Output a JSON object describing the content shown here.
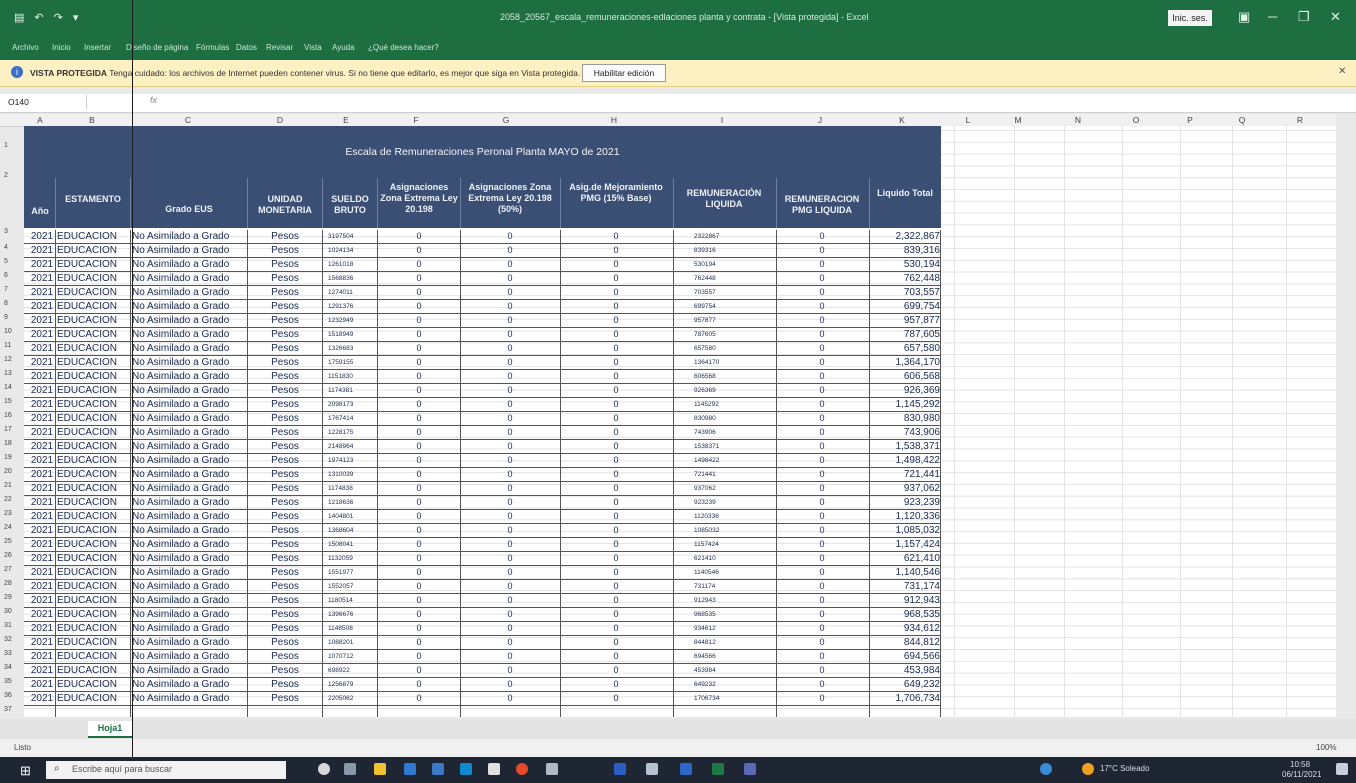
{
  "window": {
    "filename": "2058_20567_escala_remuneraciones-edlaciones planta y contrata - [Vista protegida] - Excel",
    "signin_label": "Inic. ses."
  },
  "ribbon_tabs": [
    "Archivo",
    "Inicio",
    "Insertar",
    "Diseño de página",
    "Fórmulas",
    "Datos",
    "Revisar",
    "Vista",
    "Ayuda",
    "¿Qué desea hacer?"
  ],
  "protected_view": {
    "label": "VISTA PROTEGIDA",
    "message": "Tenga cuidado: los archivos de Internet pueden contener virus. Si no tiene que editarlo, es mejor que siga en Vista protegida.",
    "enable_button": "Habilitar edición"
  },
  "formula_bar": {
    "name_box": "O140",
    "fx": "fx"
  },
  "columns": [
    "A",
    "B",
    "C",
    "D",
    "E",
    "F",
    "G",
    "H",
    "I",
    "J",
    "K",
    "L",
    "M",
    "N",
    "O",
    "P",
    "Q",
    "R"
  ],
  "table": {
    "title": "Escala de Remuneraciones Peronal Planta MAYO de 2021",
    "headers": [
      "Año",
      "ESTAMENTO",
      "Grado EUS",
      "UNIDAD MONETARIA",
      "SUELDO BRUTO",
      "Asignaciones Zona Extrema Ley 20.198",
      "Asignaciones Zona Extrema Ley 20.198 (50%)",
      "Asig.de Mejoramiento PMG (15% Base)",
      "REMUNERACIÓN LIQUIDA",
      "REMUNERACION PMG LIQUIDA",
      "Liquido Total"
    ],
    "rows": [
      [
        "2021",
        "EDUCACION",
        "No Asimilado a Grado",
        "Pesos",
        "3197504",
        "0",
        "0",
        "0",
        "2322867",
        "0",
        "2,322,867"
      ],
      [
        "2021",
        "EDUCACION",
        "No Asimilado a Grado",
        "Pesos",
        "1024134",
        "0",
        "0",
        "0",
        "839316",
        "0",
        "839,316"
      ],
      [
        "2021",
        "EDUCACION",
        "No Asimilado a Grado",
        "Pesos",
        "1261018",
        "0",
        "0",
        "0",
        "530194",
        "0",
        "530,194"
      ],
      [
        "2021",
        "EDUCACION",
        "No Asimilado a Grado",
        "Pesos",
        "1568836",
        "0",
        "0",
        "0",
        "762448",
        "0",
        "762,448"
      ],
      [
        "2021",
        "EDUCACION",
        "No Asimilado a Grado",
        "Pesos",
        "1274011",
        "0",
        "0",
        "0",
        "703557",
        "0",
        "703,557"
      ],
      [
        "2021",
        "EDUCACION",
        "No Asimilado a Grado",
        "Pesos",
        "1291376",
        "0",
        "0",
        "0",
        "699754",
        "0",
        "699,754"
      ],
      [
        "2021",
        "EDUCACION",
        "No Asimilado a Grado",
        "Pesos",
        "1232949",
        "0",
        "0",
        "0",
        "957877",
        "0",
        "957,877"
      ],
      [
        "2021",
        "EDUCACION",
        "No Asimilado a Grado",
        "Pesos",
        "1518949",
        "0",
        "0",
        "0",
        "787605",
        "0",
        "787,605"
      ],
      [
        "2021",
        "EDUCACION",
        "No Asimilado a Grado",
        "Pesos",
        "1326683",
        "0",
        "0",
        "0",
        "657580",
        "0",
        "657,580"
      ],
      [
        "2021",
        "EDUCACION",
        "No Asimilado a Grado",
        "Pesos",
        "1759155",
        "0",
        "0",
        "0",
        "1364170",
        "0",
        "1,364,170"
      ],
      [
        "2021",
        "EDUCACION",
        "No Asimilado a Grado",
        "Pesos",
        "1151830",
        "0",
        "0",
        "0",
        "606568",
        "0",
        "606,568"
      ],
      [
        "2021",
        "EDUCACION",
        "No Asimilado a Grado",
        "Pesos",
        "1174381",
        "0",
        "0",
        "0",
        "926369",
        "0",
        "926,369"
      ],
      [
        "2021",
        "EDUCACION",
        "No Asimilado a Grado",
        "Pesos",
        "2098173",
        "0",
        "0",
        "0",
        "1145292",
        "0",
        "1,145,292"
      ],
      [
        "2021",
        "EDUCACION",
        "No Asimilado a Grado",
        "Pesos",
        "1767414",
        "0",
        "0",
        "0",
        "830980",
        "0",
        "830,980"
      ],
      [
        "2021",
        "EDUCACION",
        "No Asimilado a Grado",
        "Pesos",
        "1228175",
        "0",
        "0",
        "0",
        "743906",
        "0",
        "743,906"
      ],
      [
        "2021",
        "EDUCACION",
        "No Asimilado a Grado",
        "Pesos",
        "2148964",
        "0",
        "0",
        "0",
        "1538371",
        "0",
        "1,538,371"
      ],
      [
        "2021",
        "EDUCACION",
        "No Asimilado a Grado",
        "Pesos",
        "1974123",
        "0",
        "0",
        "0",
        "1498422",
        "0",
        "1,498,422"
      ],
      [
        "2021",
        "EDUCACION",
        "No Asimilado a Grado",
        "Pesos",
        "1310039",
        "0",
        "0",
        "0",
        "721441",
        "0",
        "721,441"
      ],
      [
        "2021",
        "EDUCACION",
        "No Asimilado a Grado",
        "Pesos",
        "1174838",
        "0",
        "0",
        "0",
        "937062",
        "0",
        "937,062"
      ],
      [
        "2021",
        "EDUCACION",
        "No Asimilado a Grado",
        "Pesos",
        "1218636",
        "0",
        "0",
        "0",
        "923239",
        "0",
        "923,239"
      ],
      [
        "2021",
        "EDUCACION",
        "No Asimilado a Grado",
        "Pesos",
        "1404801",
        "0",
        "0",
        "0",
        "1120336",
        "0",
        "1,120,336"
      ],
      [
        "2021",
        "EDUCACION",
        "No Asimilado a Grado",
        "Pesos",
        "1368604",
        "0",
        "0",
        "0",
        "1085032",
        "0",
        "1,085,032"
      ],
      [
        "2021",
        "EDUCACION",
        "No Asimilado a Grado",
        "Pesos",
        "1508041",
        "0",
        "0",
        "0",
        "1157424",
        "0",
        "1,157,424"
      ],
      [
        "2021",
        "EDUCACION",
        "No Asimilado a Grado",
        "Pesos",
        "1132059",
        "0",
        "0",
        "0",
        "621410",
        "0",
        "621,410"
      ],
      [
        "2021",
        "EDUCACION",
        "No Asimilado a Grado",
        "Pesos",
        "1551977",
        "0",
        "0",
        "0",
        "1140546",
        "0",
        "1,140,546"
      ],
      [
        "2021",
        "EDUCACION",
        "No Asimilado a Grado",
        "Pesos",
        "1552057",
        "0",
        "0",
        "0",
        "731174",
        "0",
        "731,174"
      ],
      [
        "2021",
        "EDUCACION",
        "No Asimilado a Grado",
        "Pesos",
        "1180514",
        "0",
        "0",
        "0",
        "912943",
        "0",
        "912,943"
      ],
      [
        "2021",
        "EDUCACION",
        "No Asimilado a Grado",
        "Pesos",
        "1396676",
        "0",
        "0",
        "0",
        "968535",
        "0",
        "968,535"
      ],
      [
        "2021",
        "EDUCACION",
        "No Asimilado a Grado",
        "Pesos",
        "1148508",
        "0",
        "0",
        "0",
        "934612",
        "0",
        "934,612"
      ],
      [
        "2021",
        "EDUCACION",
        "No Asimilado a Grado",
        "Pesos",
        "1088201",
        "0",
        "0",
        "0",
        "844812",
        "0",
        "844,812"
      ],
      [
        "2021",
        "EDUCACION",
        "No Asimilado a Grado",
        "Pesos",
        "1070712",
        "0",
        "0",
        "0",
        "694566",
        "0",
        "694,566"
      ],
      [
        "2021",
        "EDUCACION",
        "No Asimilado a Grado",
        "Pesos",
        "698922",
        "0",
        "0",
        "0",
        "453984",
        "0",
        "453,984"
      ],
      [
        "2021",
        "EDUCACION",
        "No Asimilado a Grado",
        "Pesos",
        "1256879",
        "0",
        "0",
        "0",
        "649232",
        "0",
        "649,232"
      ],
      [
        "2021",
        "EDUCACION",
        "No Asimilado a Grado",
        "Pesos",
        "2205062",
        "0",
        "0",
        "0",
        "1706734",
        "0",
        "1,706,734"
      ]
    ]
  },
  "sheet_tab": "Hoja1",
  "status": {
    "text": "Listo",
    "zoom": "100%"
  },
  "taskbar": {
    "search_placeholder": "Escribe aquí para buscar",
    "weather": "17°C Soleado",
    "time": "10:58",
    "date": "06/11/2021"
  }
}
